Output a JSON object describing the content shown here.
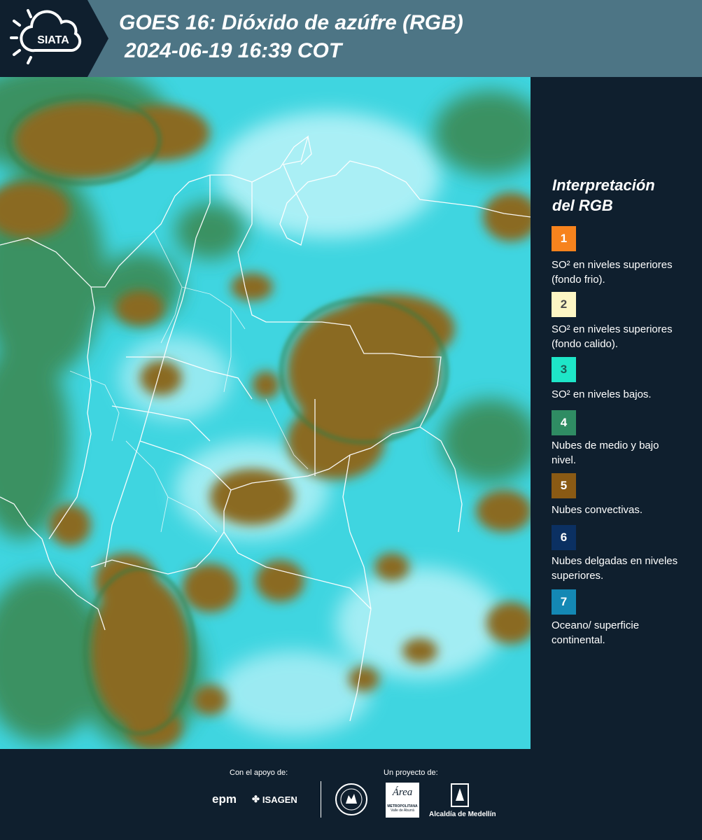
{
  "header": {
    "logo_text": "SIATA",
    "title_line1": "GOES 16: Dióxido de azúfre (RGB)",
    "title_line2": "2024-06-19 16:39 COT"
  },
  "legend": {
    "title_line1": "Interpretación",
    "title_line2": "del RGB",
    "items": [
      {
        "number": "1",
        "color": "#f7831d",
        "text_color": "#ffffff",
        "label": "SO² en niveles superiores (fondo frio)."
      },
      {
        "number": "2",
        "color": "#fdf6c4",
        "text_color": "#4a4a4a",
        "label": "SO² en niveles superiores (fondo calido)."
      },
      {
        "number": "3",
        "color": "#1ee6c8",
        "text_color": "#1b5b55",
        "label": "SO² en niveles bajos."
      },
      {
        "number": "4",
        "color": "#2f8c63",
        "text_color": "#ffffff",
        "label": "Nubes de medio y bajo nivel."
      },
      {
        "number": "5",
        "color": "#8a5a14",
        "text_color": "#ffffff",
        "label": "Nubes convectivas."
      },
      {
        "number": "6",
        "color": "#0b3062",
        "text_color": "#ffffff",
        "label": "Nubes delgadas en niveles superiores."
      },
      {
        "number": "7",
        "color": "#1488b4",
        "text_color": "#ffffff",
        "label": "Oceano/ superficie continental."
      }
    ]
  },
  "footer": {
    "support_label": "Con el apoyo de:",
    "project_label": "Un proyecto de:",
    "sponsors": [
      "epm",
      "ISAGEN"
    ],
    "metro_logo_word": "Área",
    "metro_logo_caption": "METROPOLITANA",
    "metro_logo_sub": "Valle de Aburrá",
    "city_label": "Alcaldía de Medellín"
  },
  "colors": {
    "header_bg": "#4d7585",
    "panel_bg": "#0f1f2e",
    "map_base": "#3fd5e0",
    "convective_cloud": "#8a6a22",
    "mid_low_cloud": "#3a8a55"
  }
}
